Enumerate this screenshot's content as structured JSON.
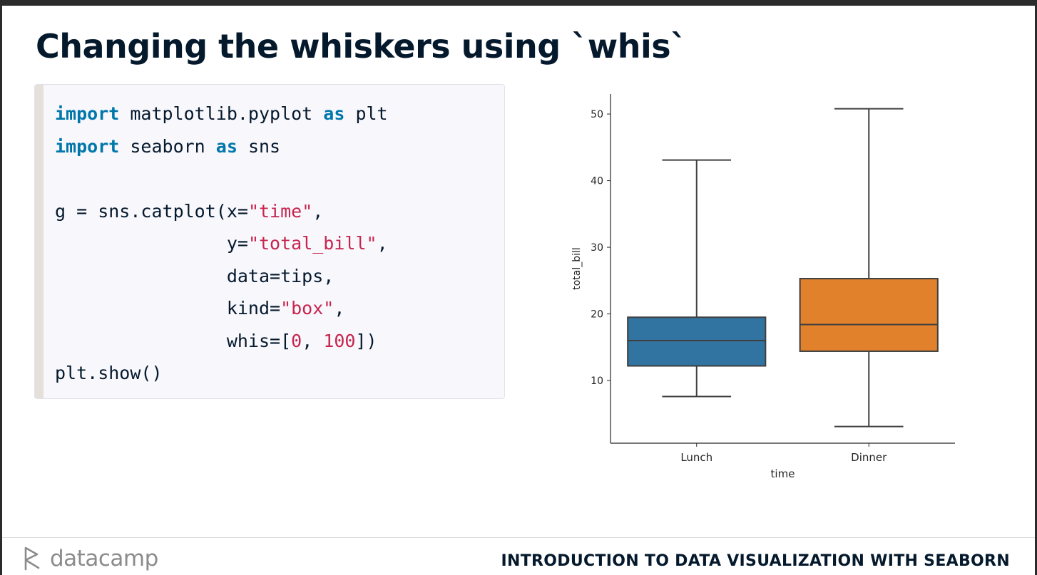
{
  "slide": {
    "title": "Changing the whiskers using `whis`"
  },
  "code": {
    "lines": [
      [
        {
          "t": "import",
          "c": "kw"
        },
        {
          "t": " matplotlib.pyplot "
        },
        {
          "t": "as",
          "c": "kw"
        },
        {
          "t": " plt"
        }
      ],
      [
        {
          "t": "import",
          "c": "kw"
        },
        {
          "t": " seaborn "
        },
        {
          "t": "as",
          "c": "kw"
        },
        {
          "t": " sns"
        }
      ],
      [],
      [
        {
          "t": "g = sns.catplot(x="
        },
        {
          "t": "\"time\"",
          "c": "str"
        },
        {
          "t": ","
        }
      ],
      [
        {
          "t": "                y="
        },
        {
          "t": "\"total_bill\"",
          "c": "str"
        },
        {
          "t": ","
        }
      ],
      [
        {
          "t": "                data=tips,"
        }
      ],
      [
        {
          "t": "                kind="
        },
        {
          "t": "\"box\"",
          "c": "str"
        },
        {
          "t": ","
        }
      ],
      [
        {
          "t": "                whis=["
        },
        {
          "t": "0",
          "c": "str"
        },
        {
          "t": ", "
        },
        {
          "t": "100",
          "c": "str"
        },
        {
          "t": "])"
        }
      ],
      [
        {
          "t": "plt.show()"
        }
      ]
    ]
  },
  "chart_data": {
    "type": "box",
    "xlabel": "time",
    "ylabel": "total_bill",
    "ylim": [
      0.6,
      53.0
    ],
    "yticks": [
      10,
      20,
      30,
      40,
      50
    ],
    "categories": [
      "Lunch",
      "Dinner"
    ],
    "boxes": [
      {
        "category": "Lunch",
        "min": 7.6,
        "q1": 12.2,
        "median": 16.0,
        "q3": 19.5,
        "max": 43.1,
        "color": "#3274a1"
      },
      {
        "category": "Dinner",
        "min": 3.1,
        "q1": 14.4,
        "median": 18.4,
        "q3": 25.3,
        "max": 50.8,
        "color": "#e1812c"
      }
    ],
    "line_color": "#3f3f3f"
  },
  "footer": {
    "logo_text": "datacamp",
    "course": "INTRODUCTION TO DATA VISUALIZATION WITH SEABORN"
  }
}
